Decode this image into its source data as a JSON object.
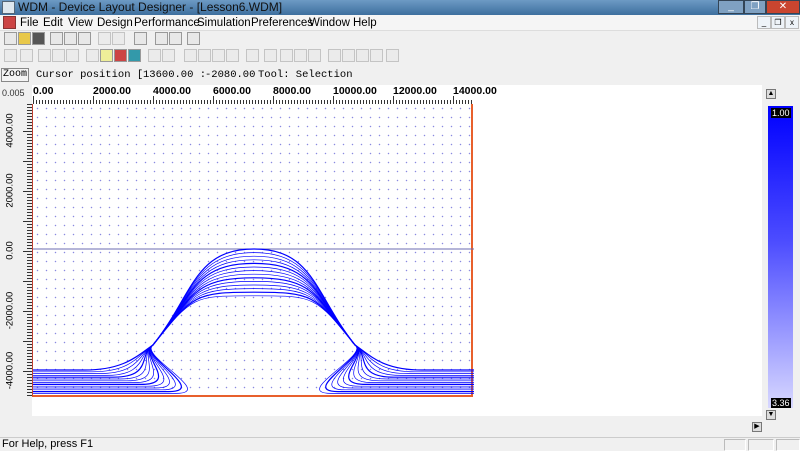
{
  "window": {
    "title": "WDM - Device Layout Designer - [Lesson6.WDM]",
    "icon": "wdm-app-icon"
  },
  "menu": [
    "File",
    "Edit",
    "View",
    "Design",
    "Performance",
    "Simulation",
    "Preferences",
    "Window",
    "Help"
  ],
  "zoombar": {
    "zoom_label": "Zoom",
    "cursor_label": "Cursor position [",
    "cursor_x": "13600.00 :",
    "cursor_y": "-2080.00",
    "tool": "Tool: Selection"
  },
  "ruler": {
    "corner": "0.005",
    "x_ticks": [
      "0.00",
      "2000.00",
      "4000.00",
      "6000.00",
      "8000.00",
      "10000.00",
      "12000.00",
      "14000.00"
    ],
    "y_ticks": [
      "4000.00",
      "2000.00",
      "0.00",
      "-2000.00",
      "-4000.00"
    ]
  },
  "colorbar": {
    "max": "1.00",
    "min": "3.36",
    "top_color": "#0000ff",
    "bottom_color": "#d8d8ff"
  },
  "status": {
    "text": "For Help, press F1"
  },
  "colors": {
    "waveguide": "#0000ff",
    "boundary": "#e8602c"
  }
}
